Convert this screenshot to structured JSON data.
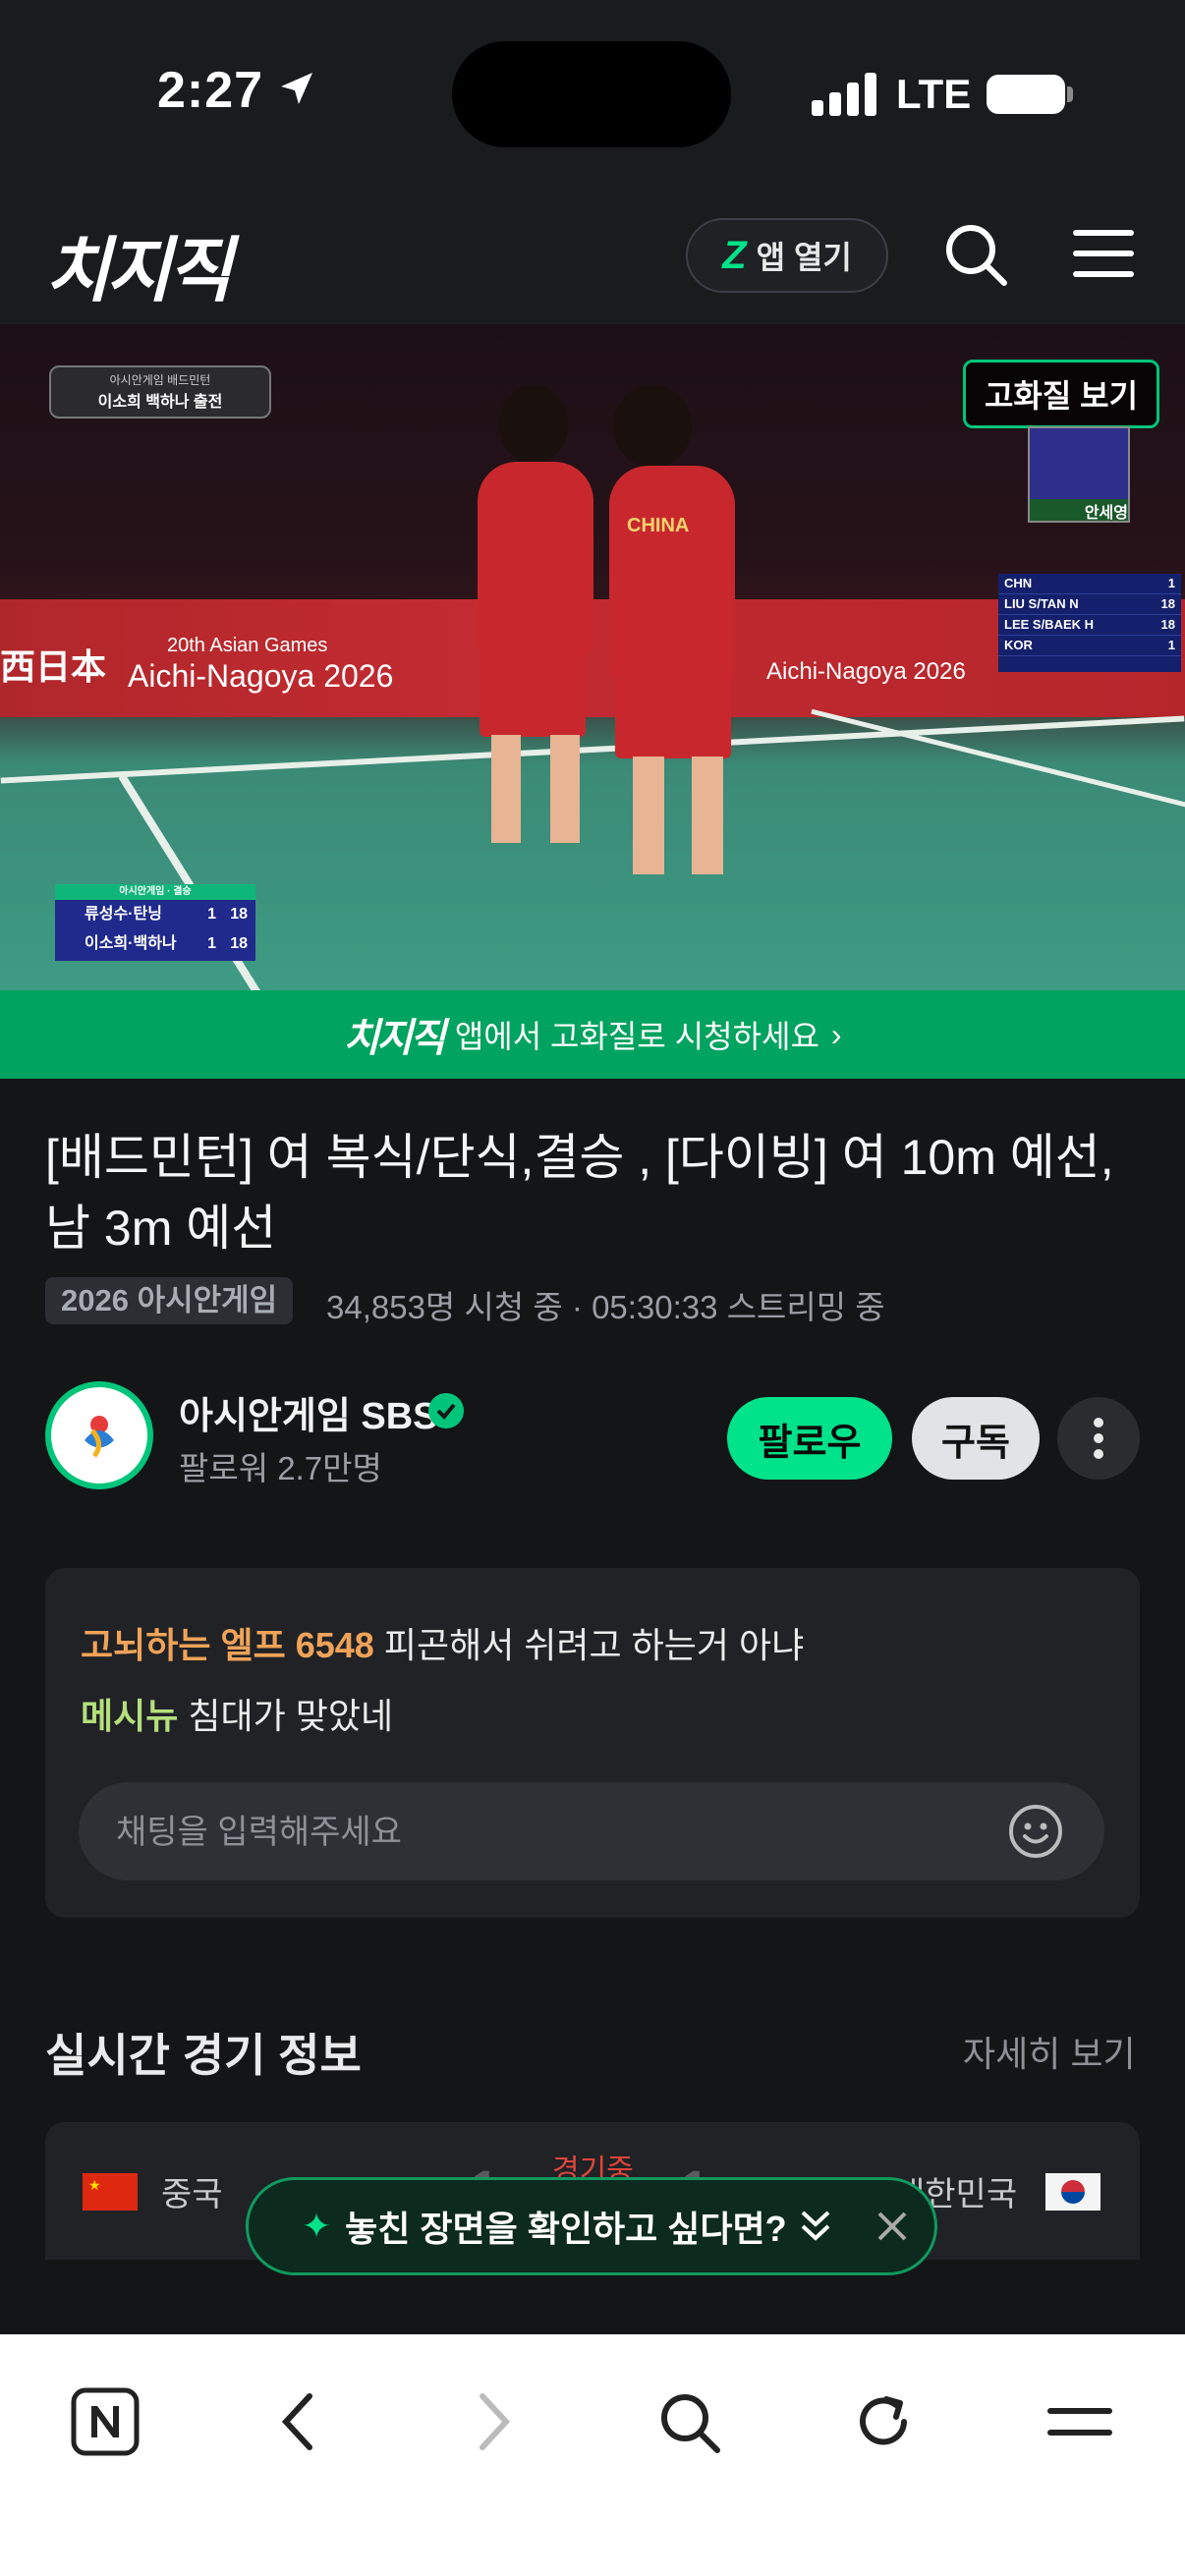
{
  "status_bar": {
    "time": "2:27",
    "network": "LTE"
  },
  "header": {
    "logo": "치지직",
    "app_open_label": "앱 열기",
    "app_open_icon": "Z"
  },
  "video": {
    "overlay_topleft_line1": "아시안게임 배드민턴",
    "overlay_topleft_line2": "이소희 백하나 출전",
    "hq_button_label": "고화질 보기",
    "commentator_name": "안세영",
    "hoarding_left": "20th Asian Games",
    "hoarding_left_2": "Aichi-Nagoya 2026",
    "hoarding_right": "Aichi-Nagoya 2026",
    "hoarding_jp": "西日本",
    "jersey_text": "CHINA",
    "scoreboard_right": [
      {
        "team": "CHN",
        "score": "1"
      },
      {
        "team": "LIU S/TAN N",
        "score": "18"
      },
      {
        "team": "LEE S/BAEK H",
        "score": "18"
      },
      {
        "team": "KOR",
        "score": "1"
      }
    ],
    "scoreboard_left_header": "아시안게임 · 결승",
    "scoreboard_left": [
      {
        "team": "류성수·탄닝",
        "set": "1",
        "score": "18"
      },
      {
        "team": "이소희·백하나",
        "set": "1",
        "score": "18"
      }
    ]
  },
  "promo": {
    "logo": "치지직",
    "text": "앱에서 고화질로 시청하세요",
    "chevron": "›"
  },
  "stream": {
    "title": "[배드민턴] 여 복식/단식,결승 , [다이빙] 여 10m 예선,남 3m 예선",
    "category": "2026 아시안게임",
    "viewers": "34,853명 시청 중",
    "separator": "·",
    "duration": "05:30:33 스트리밍 중"
  },
  "channel": {
    "name": "아시안게임 SBS",
    "followers": "팔로워 2.7만명",
    "follow_label": "팔로우",
    "subscribe_label": "구독"
  },
  "chat": {
    "messages": [
      {
        "nick": "고뇌하는 엘프 6548",
        "text": "피곤해서 쉬려고 하는거 아냐"
      },
      {
        "nick": "메시뉴",
        "text": "침대가 맞았네"
      }
    ],
    "input_placeholder": "채팅을 입력해주세요"
  },
  "live_match": {
    "section_title": "실시간 경기 정보",
    "more_label": "자세히 보기",
    "team1": "중국",
    "team2": "대한민국",
    "score1": "1",
    "score2": "1",
    "status": "경기중"
  },
  "toast": {
    "text": "놓친 장면을 확인하고 싶다면?",
    "icon_left": "✦",
    "icon_right": "⌄"
  },
  "colors": {
    "accent": "#00e38a",
    "brand_green": "#00a35f",
    "background": "#141517",
    "nick_orange": "#f0a358",
    "nick_green": "#b5df7c"
  }
}
